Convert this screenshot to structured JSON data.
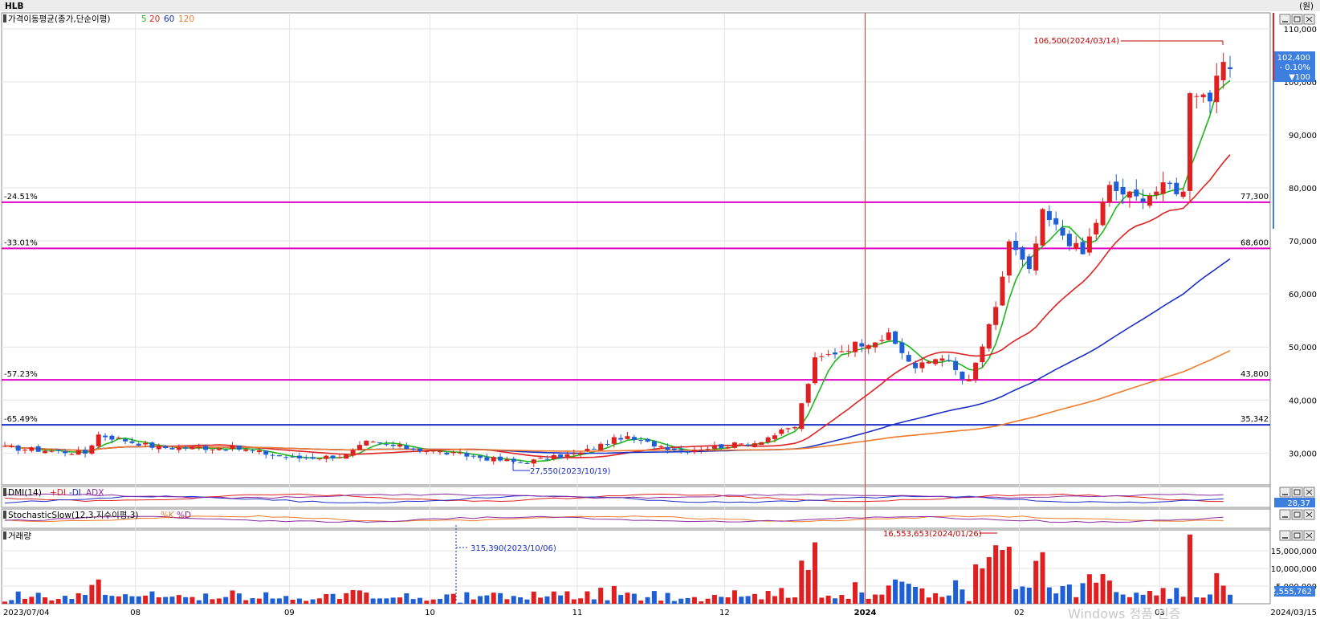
{
  "app": {
    "symbol": "HLB",
    "unit": "(원)"
  },
  "colors": {
    "up": "#e02020",
    "down": "#1f5fd6",
    "ma5": "#1db81d",
    "ma20": "#e02020",
    "ma60": "#1a2fc8",
    "ma120": "#f07b2a",
    "hline": "#e000c8",
    "crosshair": "#e53030",
    "current_badge": "#3d7fe0"
  },
  "legends": {
    "ma": {
      "label": "가격이동평균(종가,단순이평)",
      "p5": "5",
      "p20": "20",
      "p60": "60",
      "p120": "120"
    },
    "dmi": {
      "label": "DMI(14)",
      "plus": "+DI",
      "minus": "-DI",
      "adx": "ADX",
      "value": "28,37"
    },
    "stoch": {
      "label": "StochasticSlow(12,3,지수이평,3)",
      "k": "%K",
      "d": "%D"
    },
    "volume": {
      "label": "거래량"
    }
  },
  "price_axis": {
    "ticks": [
      "110,000",
      "100,000",
      "90,000",
      "80,000",
      "70,000",
      "60,000",
      "50,000",
      "40,000",
      "30,000"
    ]
  },
  "volume_axis": {
    "ticks": [
      "15,000,000",
      "10,000,000",
      "5,000,000"
    ],
    "current": "2,555,762"
  },
  "current_price": {
    "price": "102,400",
    "change_pct": "- 0.10%",
    "change": "▼100"
  },
  "lines": [
    {
      "left": "-24.51%",
      "right": "77,300",
      "price": 77300,
      "color": "#e000c8"
    },
    {
      "left": "-33.01%",
      "right": "68,600",
      "price": 68600,
      "color": "#e000c8"
    },
    {
      "left": "-57.23%",
      "right": "43,800",
      "price": 43800,
      "color": "#e000c8"
    },
    {
      "left": "-65.49%",
      "right": "35,342",
      "price": 35342,
      "color": "#1a2fc8"
    }
  ],
  "annotations": {
    "high": "106,500(2024/03/14)",
    "low": "27,550(2023/10/19)",
    "vol_high": "16,553,653(2024/01/26)",
    "vol_low": "315,390(2023/10/06)"
  },
  "x_axis": {
    "start": "2023/07/04",
    "end": "2024/03/15",
    "months": [
      "08",
      "09",
      "10",
      "11",
      "12",
      "2024",
      "02",
      "03"
    ]
  },
  "watermark": "Windows 정품 인증",
  "chart_data": {
    "type": "candlestick",
    "ylim": [
      24000,
      113000
    ],
    "anchors": [
      [
        "2023/07/04",
        31000
      ],
      [
        "2023/07/20",
        30000
      ],
      [
        "2023/07/24",
        33500
      ],
      [
        "2023/08/04",
        31000
      ],
      [
        "2023/08/21",
        31000
      ],
      [
        "2023/09/01",
        29000
      ],
      [
        "2023/09/13",
        29500
      ],
      [
        "2023/09/18",
        32000
      ],
      [
        "2023/10/04",
        30000
      ],
      [
        "2023/10/19",
        28200
      ],
      [
        "2023/11/01",
        30000
      ],
      [
        "2023/11/09",
        33000
      ],
      [
        "2023/11/22",
        30500
      ],
      [
        "2023/12/07",
        32000
      ],
      [
        "2023/12/15",
        35000
      ],
      [
        "2023/12/20",
        47500
      ],
      [
        "2023/12/28",
        50500
      ],
      [
        "2024/01/04",
        52000
      ],
      [
        "2024/01/10",
        46000
      ],
      [
        "2024/01/16",
        48500
      ],
      [
        "2024/01/19",
        44000
      ],
      [
        "2024/01/22",
        43500
      ],
      [
        "2024/01/26",
        57000
      ],
      [
        "2024/01/30",
        70000
      ],
      [
        "2024/02/02",
        64000
      ],
      [
        "2024/02/06",
        75000
      ],
      [
        "2024/02/14",
        67500
      ],
      [
        "2024/02/20",
        80000
      ],
      [
        "2024/02/26",
        78000
      ],
      [
        "2024/03/04",
        80500
      ],
      [
        "2024/03/06",
        79000
      ],
      [
        "2024/03/07",
        99000
      ],
      [
        "2024/03/12",
        97000
      ],
      [
        "2024/03/14",
        102500
      ],
      [
        "2024/03/15",
        102400
      ]
    ],
    "series": [
      {
        "name": "5",
        "values": []
      },
      {
        "name": "20",
        "values": []
      },
      {
        "name": "60",
        "values": []
      },
      {
        "name": "120",
        "values": []
      }
    ],
    "volume_ylim": [
      0,
      20000000
    ],
    "volume_peaks": [
      [
        "2024/01/26",
        16553653
      ],
      [
        "2023/10/06",
        315390
      ],
      [
        "2024/03/15",
        2555762
      ]
    ]
  }
}
